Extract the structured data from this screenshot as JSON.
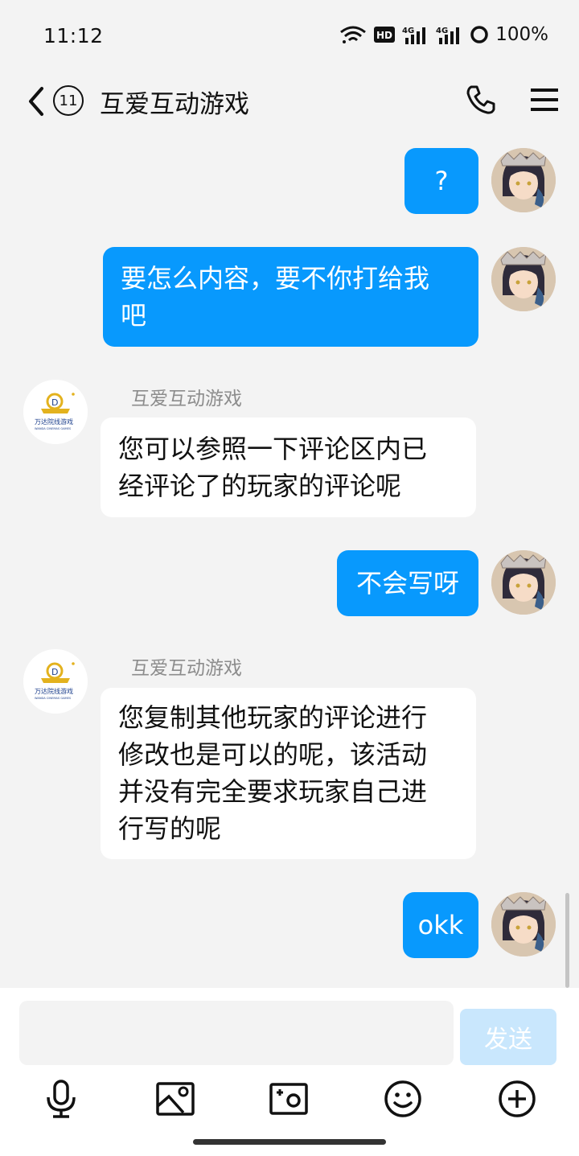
{
  "status_bar": {
    "time": "11:12",
    "hd_label": "HD",
    "net1": "4G",
    "net2": "4G",
    "battery": "100%"
  },
  "header": {
    "unread_count": "11",
    "title": "互爱互动游戏"
  },
  "colors": {
    "outgoing_bubble": "#0899fd",
    "incoming_bubble": "#ffffff",
    "send_button_disabled": "#c9e7fd",
    "background": "#f3f3f3"
  },
  "messages": [
    {
      "direction": "out",
      "text": "?"
    },
    {
      "direction": "out",
      "line1": "要怎么内容，要不你打给我",
      "line2": "吧"
    },
    {
      "direction": "in",
      "sender": "互爱互动游戏",
      "line1": "您可以参照一下评论区内已",
      "line2": "经评论了的玩家的评论呢"
    },
    {
      "direction": "out",
      "text": "不会写呀"
    },
    {
      "direction": "in",
      "sender": "互爱互动游戏",
      "line1": "您复制其他玩家的评论进行",
      "line2": "修改也是可以的呢，该活动",
      "line3": "并没有完全要求玩家自己进",
      "line4": "行写的呢"
    },
    {
      "direction": "out",
      "text": "okk"
    }
  ],
  "bot_avatar": {
    "brand_cn": "万达院线游戏",
    "brand_en": "WANDA CINEMAS GAMES"
  },
  "composer": {
    "input_value": "",
    "send_label": "发送"
  },
  "toolbar_icons": [
    "mic-icon",
    "image-icon",
    "camera-icon",
    "emoji-icon",
    "plus-icon"
  ]
}
